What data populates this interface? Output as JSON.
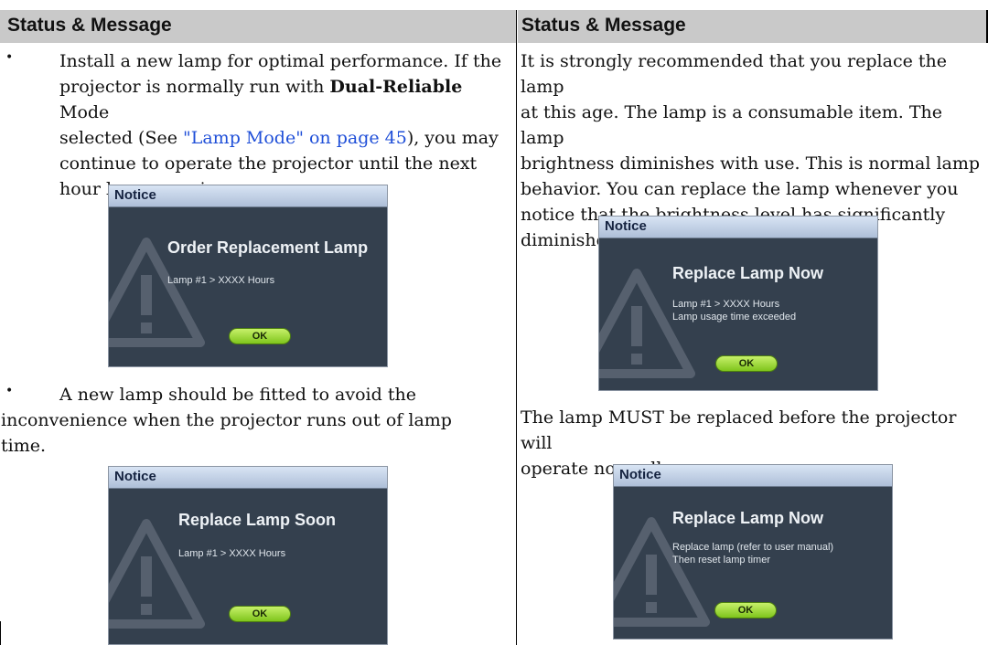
{
  "left_header": "Status & Message",
  "right_header": "Status & Message",
  "left": {
    "item1": {
      "bullet": "•",
      "line1": "Install a new lamp for optimal performance. If the",
      "line2_a": "projector is normally run with ",
      "line2_bold": "Dual-Reliable",
      "line2_b": " Mode",
      "line3_a": "selected (See ",
      "line3_link": "\"Lamp Mode\" on page 45",
      "line3_b": "), you may",
      "line4": "continue to operate the projector until the next",
      "line5": "hour lamp warning appears."
    },
    "notice1": {
      "bar": "Notice",
      "title": "Order Replacement Lamp",
      "line1": "Lamp #1 > XXXX Hours",
      "ok": "OK"
    },
    "item2": {
      "bullet": "•",
      "line1": "A new lamp should be fitted to avoid the",
      "line2": "inconvenience when the projector runs out of lamp",
      "line3": "time."
    },
    "notice2": {
      "bar": "Notice",
      "title": "Replace Lamp Soon",
      "line1": "Lamp #1 > XXXX Hours",
      "ok": "OK"
    }
  },
  "right": {
    "para1": {
      "line1": "It is strongly recommended that you replace the lamp",
      "line2": "at this age. The lamp is a consumable item. The lamp",
      "line3": "brightness diminishes with use. This is normal lamp",
      "line4": "behavior. You can replace the lamp whenever you",
      "line5": "notice that the brightness level has significantly",
      "line6": "diminished."
    },
    "notice3": {
      "bar": "Notice",
      "title": "Replace Lamp Now",
      "line1": "Lamp #1 > XXXX Hours",
      "line2": "Lamp usage time exceeded",
      "ok": "OK"
    },
    "para2": {
      "line1": "The lamp MUST be replaced before the projector will",
      "line2": "operate normally."
    },
    "notice4": {
      "bar": "Notice",
      "title": "Replace Lamp Now",
      "line1": "Replace lamp (refer to user manual)",
      "line2": "Then reset lamp timer",
      "ok": "OK"
    }
  }
}
